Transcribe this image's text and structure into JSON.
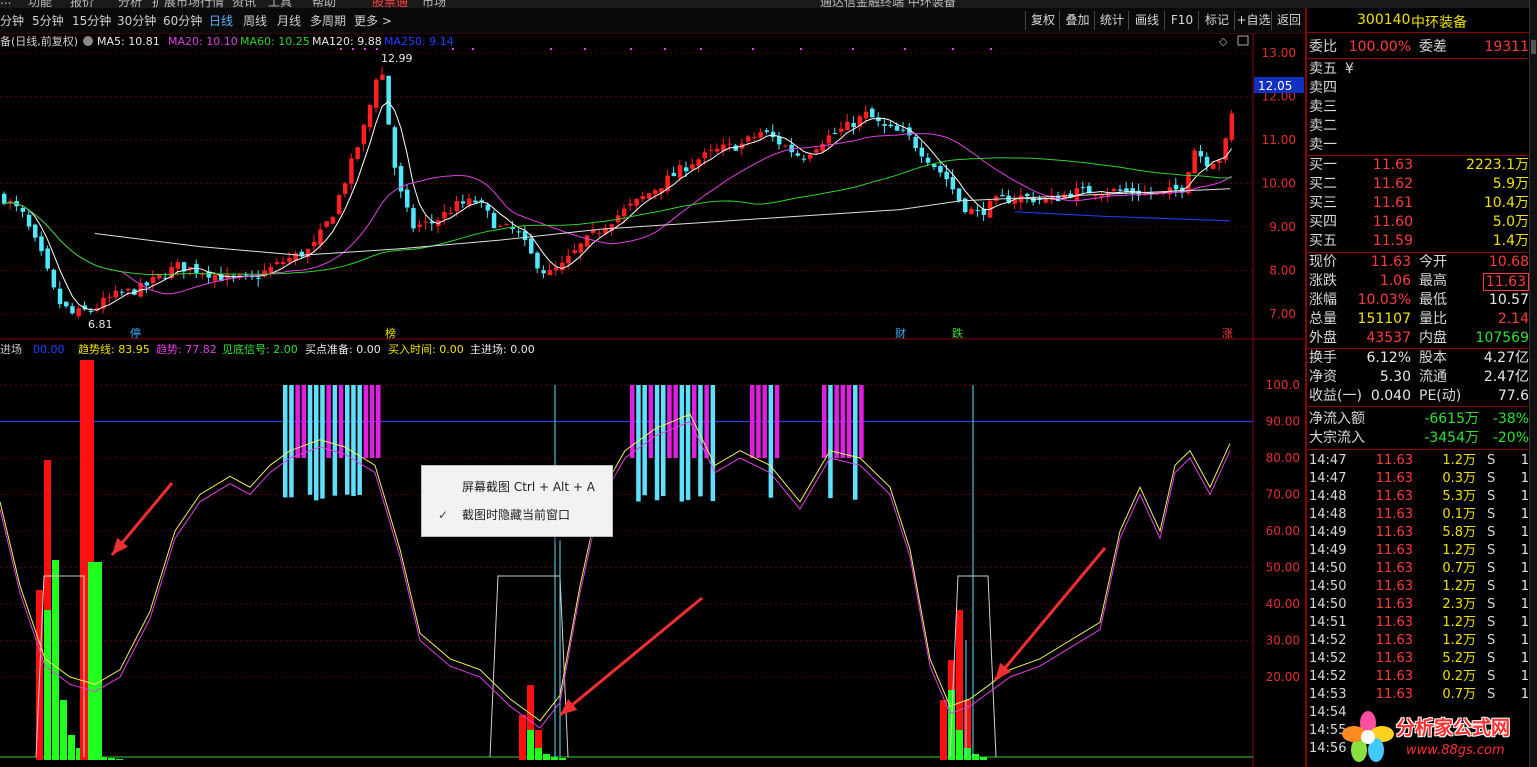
{
  "menubar": {
    "items": [
      "...",
      "功能",
      "报价",
      "分析",
      "扩展市场行情",
      "资讯",
      "工具",
      "帮助",
      "股票通",
      "市场"
    ],
    "title": "通达信金融终端 中环装备"
  },
  "toolbar": {
    "periods": [
      "分钟",
      "5分钟",
      "15分钟",
      "30分钟",
      "60分钟",
      "日线",
      "周线",
      "月线",
      "多周期",
      "更多 >"
    ],
    "active_period": "日线",
    "buttons": [
      "复权",
      "叠加",
      "统计",
      "画线",
      "F10",
      "标记",
      "+自选",
      "返回"
    ]
  },
  "main_chart": {
    "legend": {
      "prefix": "备(日线,前复权)",
      "ma5": "MA5: 10.81",
      "ma20": "MA20: 10.10",
      "ma60": "MA60: 10.25",
      "ma120": "MA120: 9.88",
      "ma250": "MA250: 9.14"
    },
    "y_ticks": [
      "13.00",
      "12.00",
      "11.00",
      "10.00",
      "9.00",
      "8.00",
      "7.00"
    ],
    "current_price_tag": "12.05",
    "high_label": "12.99",
    "low_label": "6.81",
    "event_tags": [
      {
        "label": "停",
        "color": "#3ab0ff"
      },
      {
        "label": "榜",
        "color": "#f0e000"
      },
      {
        "label": "财",
        "color": "#3ab0ff"
      },
      {
        "label": "跌",
        "color": "#30e030"
      },
      {
        "label": "涨",
        "color": "#ff3c3c"
      }
    ],
    "colors": {
      "up": "#ff2020",
      "down": "#50e8ff",
      "ma5": "#ffffff",
      "ma20": "#e040e0",
      "ma60": "#30d030",
      "ma120": "#e0e0e0",
      "ma250": "#2040ff"
    }
  },
  "indicator": {
    "legend": [
      {
        "text": "进场",
        "color": "#c8c8c8"
      },
      {
        "text": "00.00",
        "color": "#2040ff"
      },
      {
        "text": "趋势线: 83.95",
        "color": "#f0e000"
      },
      {
        "text": "趋势: 77.82",
        "color": "#e040e0"
      },
      {
        "text": "见底信号: 2.00",
        "color": "#30e030"
      },
      {
        "text": "买点准备: 0.00",
        "color": "#e8e8e8"
      },
      {
        "text": "买入时间: 0.00",
        "color": "#f0e000"
      },
      {
        "text": "主进场: 0.00",
        "color": "#e8e8e8"
      }
    ],
    "y_ticks": [
      "100.0",
      "90.00",
      "80.00",
      "70.00",
      "60.00",
      "50.00",
      "40.00",
      "30.00",
      "20.00"
    ]
  },
  "context_menu": {
    "items": [
      {
        "label": "屏幕截图 Ctrl + Alt + A",
        "checked": false
      },
      {
        "label": "截图时隐藏当前窗口",
        "checked": true
      }
    ]
  },
  "quote": {
    "code": "300140",
    "name": "中环装备",
    "weibi_label": "委比",
    "weibi": "100.00%",
    "weicha_label": "委差",
    "weicha": "19311",
    "sells": [
      {
        "label": "卖五",
        "price": "¥",
        "vol": ""
      },
      {
        "label": "卖四",
        "price": "",
        "vol": ""
      },
      {
        "label": "卖三",
        "price": "",
        "vol": ""
      },
      {
        "label": "卖二",
        "price": "",
        "vol": ""
      },
      {
        "label": "卖一",
        "price": "",
        "vol": ""
      }
    ],
    "buys": [
      {
        "label": "买一",
        "price": "11.63",
        "vol": "2223.1万"
      },
      {
        "label": "买二",
        "price": "11.62",
        "vol": "5.9万"
      },
      {
        "label": "买三",
        "price": "11.61",
        "vol": "10.4万"
      },
      {
        "label": "买四",
        "price": "11.60",
        "vol": "5.0万"
      },
      {
        "label": "买五",
        "price": "11.59",
        "vol": "1.4万"
      }
    ],
    "stats": [
      {
        "l1": "现价",
        "v1": "11.63",
        "c1": "red",
        "l2": "今开",
        "v2": "10.68",
        "c2": "red"
      },
      {
        "l1": "涨跌",
        "v1": "1.06",
        "c1": "red",
        "l2": "最高",
        "v2": "11.63",
        "c2": "red"
      },
      {
        "l1": "涨幅",
        "v1": "10.03%",
        "c1": "red",
        "l2": "最低",
        "v2": "10.57",
        "c2": "white"
      },
      {
        "l1": "总量",
        "v1": "151107",
        "c1": "yellow",
        "l2": "量比",
        "v2": "2.14",
        "c2": "red"
      },
      {
        "l1": "外盘",
        "v1": "43537",
        "c1": "red",
        "l2": "内盘",
        "v2": "107569",
        "c2": "green"
      }
    ],
    "stats2": [
      {
        "l1": "换手",
        "v1": "6.12%",
        "l2": "股本",
        "v2": "4.27亿"
      },
      {
        "l1": "净资",
        "v1": "5.30",
        "l2": "流通",
        "v2": "2.47亿"
      },
      {
        "l1": "收益(一)",
        "v1": "0.040",
        "l2": "PE(动)",
        "v2": "77.6"
      }
    ],
    "flows": [
      {
        "label": "净流入额",
        "value": "-6615万",
        "pct": "-38%"
      },
      {
        "label": "大宗流入",
        "value": "-3454万",
        "pct": "-20%"
      }
    ],
    "ticks": [
      {
        "time": "14:47",
        "price": "11.63",
        "vol": "1.2万",
        "side": "S",
        "n": "1"
      },
      {
        "time": "14:47",
        "price": "11.63",
        "vol": "0.3万",
        "side": "S",
        "n": "1"
      },
      {
        "time": "14:48",
        "price": "11.63",
        "vol": "5.3万",
        "side": "S",
        "n": "1"
      },
      {
        "time": "14:48",
        "price": "11.63",
        "vol": "0.1万",
        "side": "S",
        "n": "1"
      },
      {
        "time": "14:49",
        "price": "11.63",
        "vol": "5.8万",
        "side": "S",
        "n": "1"
      },
      {
        "time": "14:49",
        "price": "11.63",
        "vol": "1.2万",
        "side": "S",
        "n": "1"
      },
      {
        "time": "14:50",
        "price": "11.63",
        "vol": "0.7万",
        "side": "S",
        "n": "1"
      },
      {
        "time": "14:50",
        "price": "11.63",
        "vol": "1.2万",
        "side": "S",
        "n": "1"
      },
      {
        "time": "14:50",
        "price": "11.63",
        "vol": "2.3万",
        "side": "S",
        "n": "1"
      },
      {
        "time": "14:51",
        "price": "11.63",
        "vol": "1.2万",
        "side": "S",
        "n": "1"
      },
      {
        "time": "14:52",
        "price": "11.63",
        "vol": "1.2万",
        "side": "S",
        "n": "1"
      },
      {
        "time": "14:52",
        "price": "11.63",
        "vol": "5.2万",
        "side": "S",
        "n": "1"
      },
      {
        "time": "14:52",
        "price": "11.63",
        "vol": "0.2万",
        "side": "S",
        "n": "1"
      },
      {
        "time": "14:53",
        "price": "11.63",
        "vol": "0.7万",
        "side": "S",
        "n": "1"
      },
      {
        "time": "14:54",
        "price": "",
        "vol": "",
        "side": "",
        "n": ""
      },
      {
        "time": "14:55",
        "price": "",
        "vol": "",
        "side": "",
        "n": ""
      },
      {
        "time": "14:56",
        "price": "",
        "vol": "",
        "side": "",
        "n": ""
      }
    ]
  },
  "watermark": {
    "title": "分析家公式网",
    "url": "www.88gs.com"
  }
}
